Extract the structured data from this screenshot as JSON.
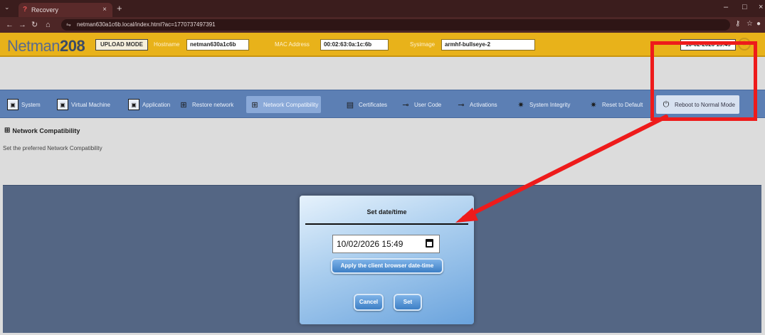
{
  "browser": {
    "tab_title": "Recovery",
    "tab_close": "×",
    "new_tab": "+",
    "url": "netman630a1c6b.local/index.html?ac=1770737497391",
    "window_controls": {
      "minimize": "–",
      "maximize": "□"
    }
  },
  "header": {
    "logo_light": "Netman",
    "logo_bold": "208",
    "mode": "UPLOAD MODE",
    "hostname_label": "Hostname",
    "hostname": "netman630a1c6b",
    "mac_label": "MAC Address",
    "mac": "00:02:63:0a:1c:6b",
    "sysimage_label": "Sysimage",
    "sysimage": "armhf-bullseye-2",
    "datetime": "10-02-2026 15:49"
  },
  "toolbar": [
    {
      "label": "System",
      "icon": "system-icon"
    },
    {
      "label": "Virtual Machine",
      "icon": "virtual-machine-icon"
    },
    {
      "label": "Application",
      "icon": "application-icon"
    },
    {
      "label": "Restore network",
      "icon": "network-icon"
    },
    {
      "label": "Network Compatibility",
      "icon": "network-icon"
    },
    {
      "label": "Certificates",
      "icon": "certificate-icon"
    },
    {
      "label": "User Code",
      "icon": "key-icon"
    },
    {
      "label": "Activations",
      "icon": "key-icon"
    },
    {
      "label": "System Integrity",
      "icon": "gear-icon"
    },
    {
      "label": "Reset to Default",
      "icon": "gear-icon"
    },
    {
      "label": "Reboot to Normal Mode",
      "icon": "power-icon"
    }
  ],
  "content": {
    "title": "Network Compatibility",
    "subtitle": "Set the preferred Network Compatibility"
  },
  "dialog": {
    "title": "Set date/time",
    "input_value": "10/02/2026 15:49",
    "apply_label": "Apply the client browser date-time",
    "cancel_label": "Cancel",
    "set_label": "Set"
  },
  "colors": {
    "header": "#e8b21a",
    "toolbar": "#5c7fb4",
    "overlay": "#546684",
    "annotation": "#ee1b1b"
  }
}
